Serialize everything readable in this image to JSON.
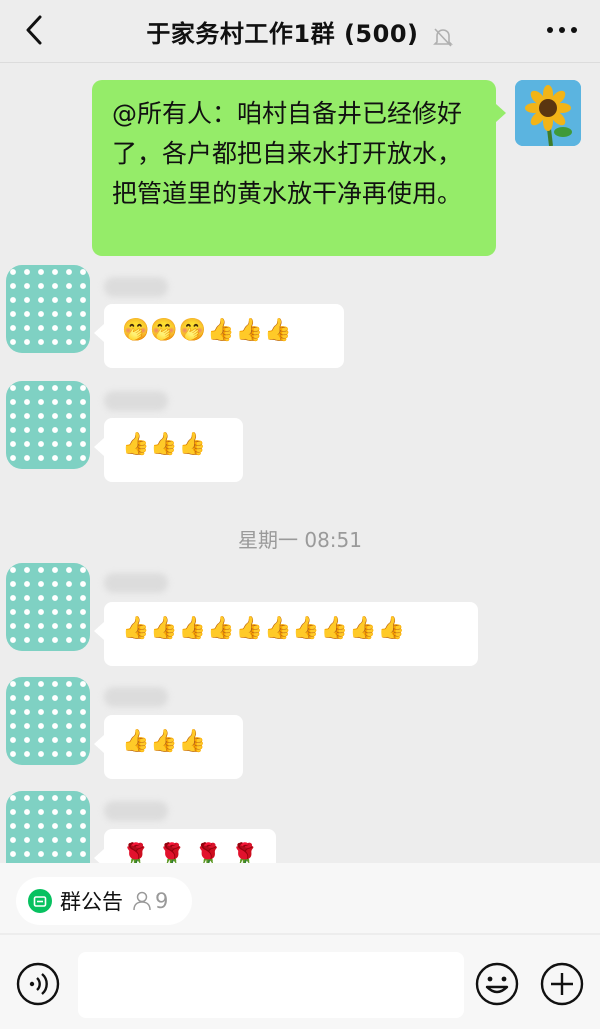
{
  "header": {
    "title": "于家务村工作1群 (500)",
    "back_icon": "chevron-left-icon",
    "mute_icon": "bell-off-icon",
    "more_icon": "ellipsis-icon"
  },
  "messages": [
    {
      "sender": "self",
      "text": "@所有人：咱村自备井已经修好了，各户都把自来水打开放水，把管道里的黄水放干净再使用。"
    },
    {
      "sender": "member",
      "text": "🤭🤭🤭👍👍👍"
    },
    {
      "sender": "member",
      "text": "👍👍👍"
    },
    {
      "type": "timestamp",
      "text": "星期一 08:51"
    },
    {
      "sender": "member",
      "text": "👍👍👍👍👍👍👍👍👍👍"
    },
    {
      "sender": "member",
      "text": "👍👍👍"
    },
    {
      "sender": "member",
      "text": "🌹 🌹 🌹 🌹"
    }
  ],
  "group_notice": {
    "label": "群公告",
    "count": "9"
  },
  "input": {
    "placeholder": ""
  },
  "colors": {
    "self_bubble": "#95ec69",
    "background": "#ededed",
    "accent": "#07c160"
  }
}
